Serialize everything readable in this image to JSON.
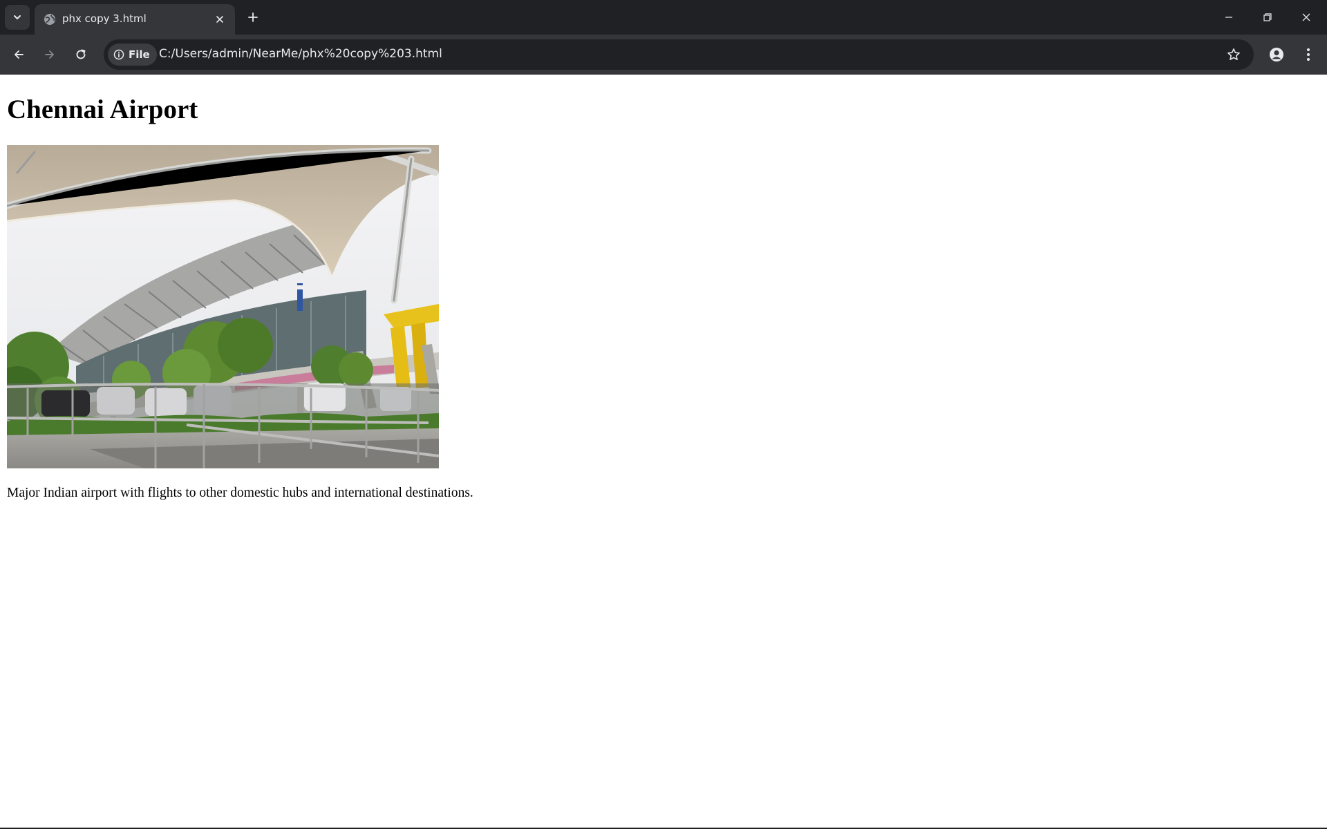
{
  "browser": {
    "tab": {
      "title": "phx copy 3.html",
      "favicon_icon": "globe-icon"
    },
    "address_bar": {
      "site_chip_label": "File",
      "url": "C:/Users/admin/NearMe/phx%20copy%203.html"
    }
  },
  "page": {
    "title": "Chennai Airport",
    "image": {
      "alt": "Chennai Airport terminal building with tensile canopy roof",
      "subject": "airport-terminal-photo"
    },
    "description": "Major Indian airport with flights to other domestic hubs and international destinations."
  },
  "colors": {
    "chrome_dark": "#202124",
    "chrome_toolbar": "#35363a",
    "chrome_text": "#e8eaed",
    "page_background": "#ffffff",
    "page_text": "#000000"
  }
}
